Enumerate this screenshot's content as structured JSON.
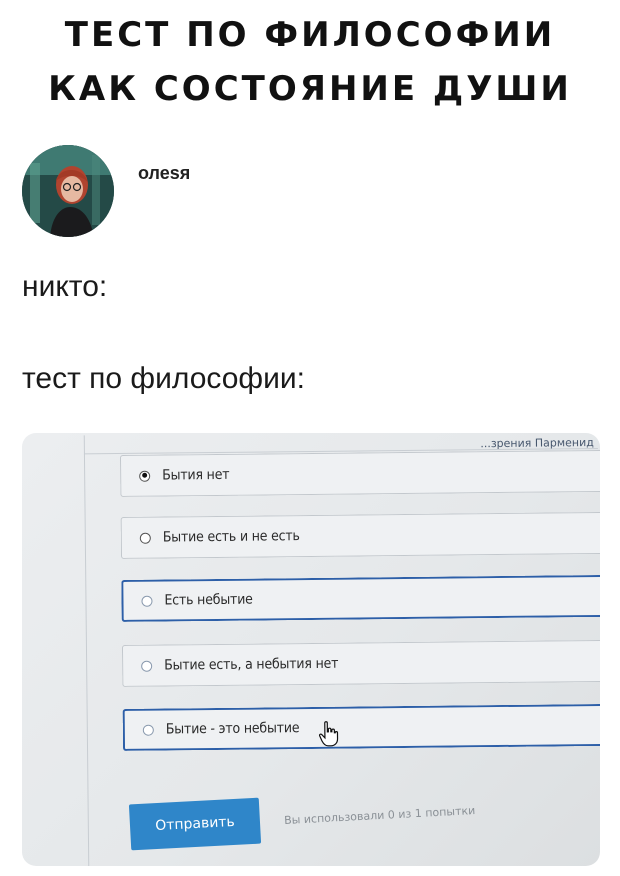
{
  "meme": {
    "title_line1": "ТЕСТ ПО ФИЛОСОФИИ",
    "title_line2": "КАК СОСТОЯНИЕ ДУШИ"
  },
  "post": {
    "username": "олеsя",
    "line1": "никто:",
    "line2": "тест по философии:"
  },
  "quiz": {
    "heading_fragment": "...зрения Парменид",
    "options": [
      {
        "label": "Бытия нет",
        "selected": true
      },
      {
        "label": "Бытие есть и не есть",
        "selected": false
      },
      {
        "label": "Есть небытие",
        "selected": false
      },
      {
        "label": "Бытие есть, а небытия нет",
        "selected": false
      },
      {
        "label": "Бытие - это небытие",
        "selected": false
      }
    ],
    "submit_label": "Отправить",
    "attempts_text": "Вы использовали 0 из 1 попытки"
  },
  "colors": {
    "accent_button": "#2f86c9",
    "focus_border": "#2d5fa8"
  },
  "icons": [
    "avatar-photo",
    "radio-checked",
    "radio-empty",
    "hand-pointer-cursor-icon"
  ]
}
